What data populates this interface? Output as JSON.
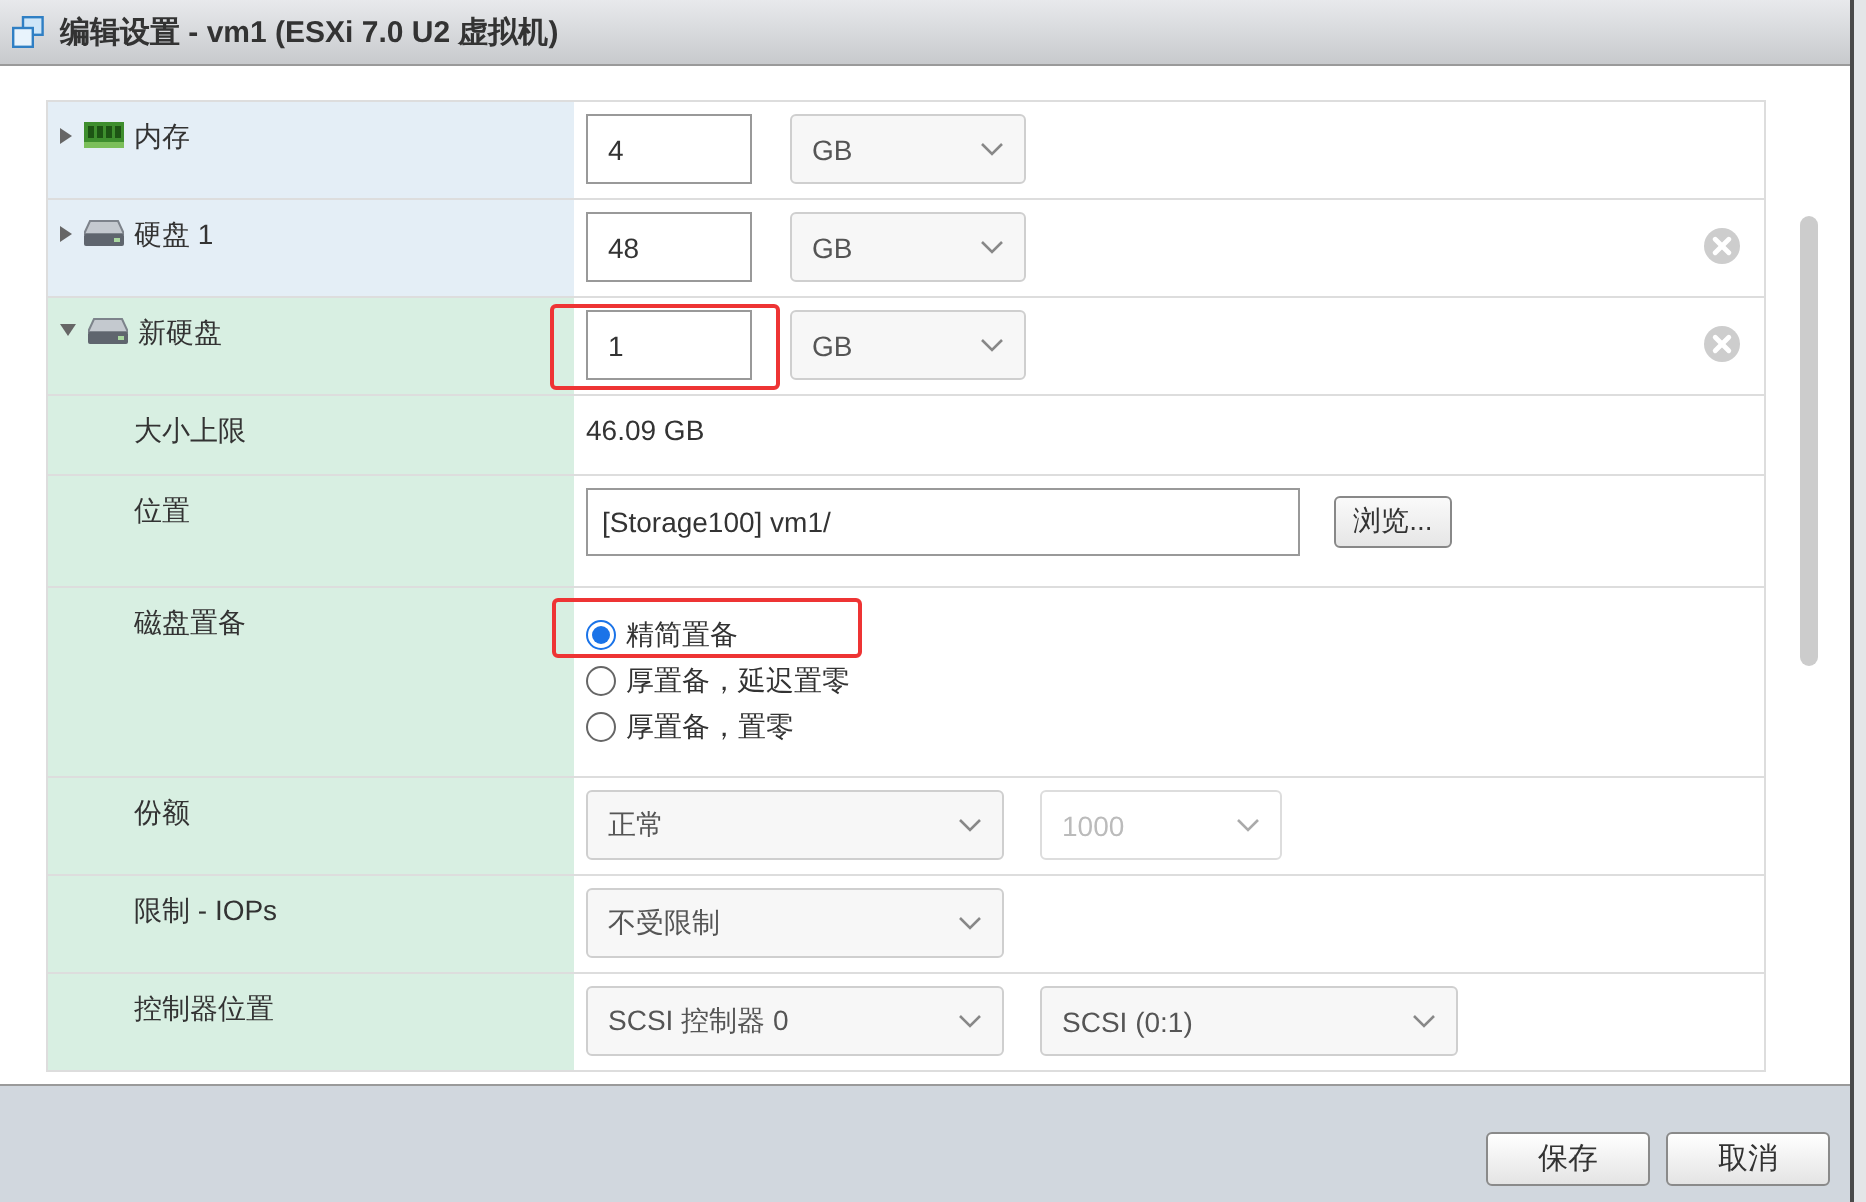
{
  "window": {
    "title": "编辑设置 - vm1 (ESXi 7.0 U2 虚拟机)"
  },
  "settings": {
    "rows": [
      {
        "kind": "memory",
        "label": "内存",
        "expanded": false,
        "is_new": false,
        "value": "4",
        "unit": "GB",
        "removable": false,
        "highlighted": false
      },
      {
        "kind": "disk",
        "label": "硬盘 1",
        "expanded": false,
        "is_new": false,
        "value": "48",
        "unit": "GB",
        "removable": true,
        "highlighted": false
      },
      {
        "kind": "disk",
        "label": "新硬盘",
        "expanded": true,
        "is_new": true,
        "value": "1",
        "unit": "GB",
        "removable": true,
        "highlighted": true,
        "children": [
          {
            "kind": "text",
            "label": "大小上限",
            "value": "46.09 GB"
          },
          {
            "kind": "path",
            "label": "位置",
            "value": "[Storage100] vm1/",
            "button": "浏览..."
          },
          {
            "kind": "radios",
            "label": "磁盘置备",
            "options": [
              {
                "label": "精简置备",
                "selected": true,
                "highlighted": true
              },
              {
                "label": "厚置备，延迟置零",
                "selected": false,
                "highlighted": false
              },
              {
                "label": "厚置备，置零",
                "selected": false,
                "highlighted": false
              }
            ]
          },
          {
            "kind": "selects",
            "label": "份额",
            "selects": [
              {
                "kind": "choice",
                "value": "正常",
                "disabled": false
              },
              {
                "kind": "number",
                "value": "1000",
                "disabled": true
              }
            ]
          },
          {
            "kind": "selects",
            "label": "限制 - IOPs",
            "selects": [
              {
                "kind": "choice",
                "value": "不受限制",
                "disabled": false
              }
            ]
          },
          {
            "kind": "selects",
            "label": "控制器位置",
            "selects": [
              {
                "kind": "choice",
                "value": "SCSI 控制器 0",
                "disabled": false
              },
              {
                "kind": "choice",
                "value": "SCSI (0:1)",
                "disabled": false
              }
            ]
          }
        ]
      }
    ]
  },
  "footer": {
    "buttons": [
      "保存",
      "取消"
    ]
  }
}
